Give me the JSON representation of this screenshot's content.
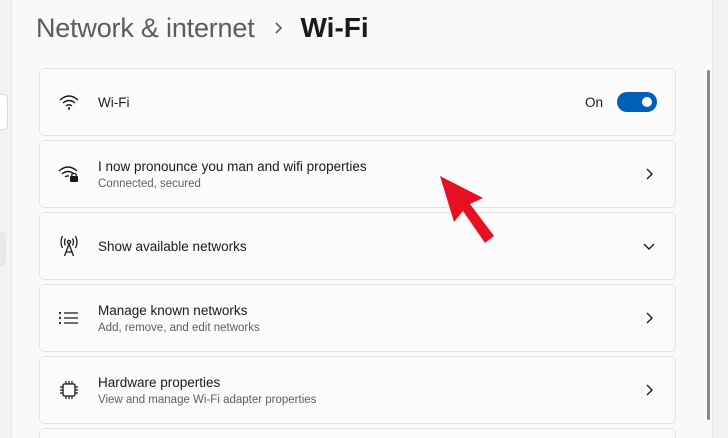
{
  "breadcrumb": {
    "parent": "Network & internet",
    "current": "Wi-Fi"
  },
  "wifi_toggle": {
    "label": "Wi-Fi",
    "state_text": "On",
    "enabled": true
  },
  "cards": [
    {
      "title": "I now pronounce you man and wifi properties",
      "subtitle": "Connected, secured",
      "icon": "wifi-lock-icon",
      "trailing": "chevron-right-icon"
    },
    {
      "title": "Show available networks",
      "subtitle": "",
      "icon": "antenna-icon",
      "trailing": "chevron-down-icon"
    },
    {
      "title": "Manage known networks",
      "subtitle": "Add, remove, and edit networks",
      "icon": "list-icon",
      "trailing": "chevron-right-icon"
    },
    {
      "title": "Hardware properties",
      "subtitle": "View and manage Wi-Fi adapter properties",
      "icon": "chip-icon",
      "trailing": "chevron-right-icon"
    }
  ],
  "colors": {
    "accent": "#005fb8",
    "annotation": "#e81123"
  }
}
